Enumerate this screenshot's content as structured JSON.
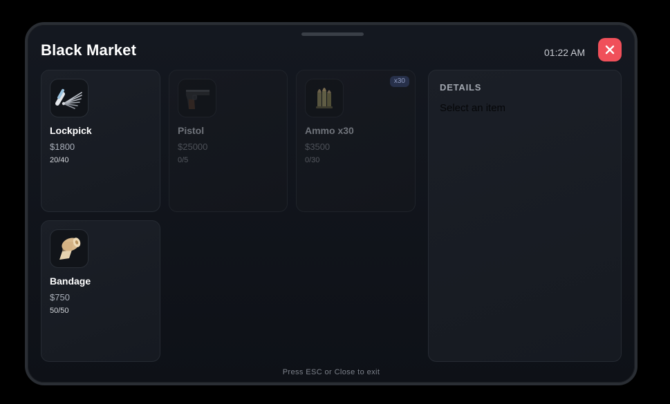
{
  "window": {
    "title": "Black Market",
    "time": "01:22 AM",
    "close_icon": "close-icon"
  },
  "items": [
    {
      "name": "Lockpick",
      "price": "$1800",
      "stock": "20/40",
      "icon": "lockpick-icon",
      "available": true
    },
    {
      "name": "Pistol",
      "price": "$25000",
      "stock": "0/5",
      "icon": "pistol-icon",
      "available": false
    },
    {
      "name": "Ammo x30",
      "price": "$3500",
      "stock": "0/30",
      "icon": "ammo-icon",
      "available": false,
      "badge": "x30"
    },
    {
      "name": "Bandage",
      "price": "$750",
      "stock": "50/50",
      "icon": "bandage-icon",
      "available": true
    }
  ],
  "details": {
    "heading": "DETAILS",
    "empty_text": "Select an item"
  },
  "footer": {
    "hint": "Press ESC or Close to exit"
  },
  "colors": {
    "close_button": "#f0505a",
    "badge_bg": "#27304a",
    "badge_text": "#8e9ac0",
    "panel_bg": "#141820"
  }
}
